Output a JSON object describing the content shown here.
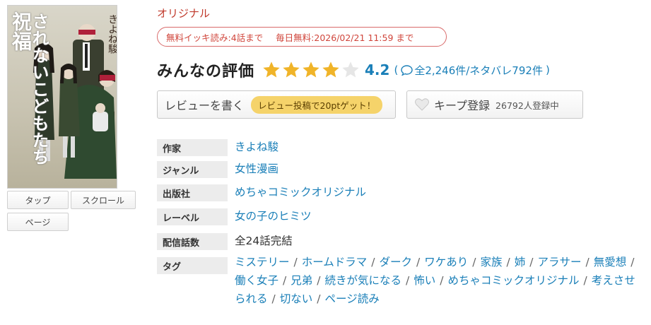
{
  "cover": {
    "title_line1": "祝福",
    "title_line2": "されないこどもたち",
    "author": "きよね駿"
  },
  "view_buttons": [
    "タップ",
    "スクロール",
    "ページ"
  ],
  "label": "オリジナル",
  "free": {
    "part1": "無料イッキ読み:4話まで",
    "part2": "毎日無料:2026/02/21 11:59 まで"
  },
  "rating": {
    "title": "みんなの評価",
    "stars_filled": 4,
    "stars_total": 5,
    "value": "4.2",
    "count_text": "全2,246件/ネタバレ792件",
    "paren_open": "(",
    "paren_close": ")"
  },
  "review_button": {
    "label": "レビューを書く",
    "pill": "レビュー投稿で20ptゲット！"
  },
  "keep_button": {
    "label": "キープ登録",
    "count": "26792人登録中"
  },
  "info": [
    {
      "key": "作家",
      "value": "きよね駿"
    },
    {
      "key": "ジャンル",
      "value": "女性漫画"
    },
    {
      "key": "出版社",
      "value": "めちゃコミックオリジナル"
    },
    {
      "key": "レーベル",
      "value": "女の子のヒミツ"
    },
    {
      "key": "配信話数",
      "value": "全24話完結"
    },
    {
      "key": "タグ",
      "value": ""
    }
  ],
  "tags": [
    "ミステリー",
    "ホームドラマ",
    "ダーク",
    "ワケあり",
    "家族",
    "姉",
    "アラサー",
    "無愛想",
    "働く女子",
    "兄弟",
    "続きが気になる",
    "怖い",
    "めちゃコミックオリジナル",
    "考えさせられる",
    "切ない",
    "ページ読み"
  ],
  "colors": {
    "link": "#1a7fb8",
    "star": "#f0b429",
    "accent_red": "#c0392b"
  }
}
